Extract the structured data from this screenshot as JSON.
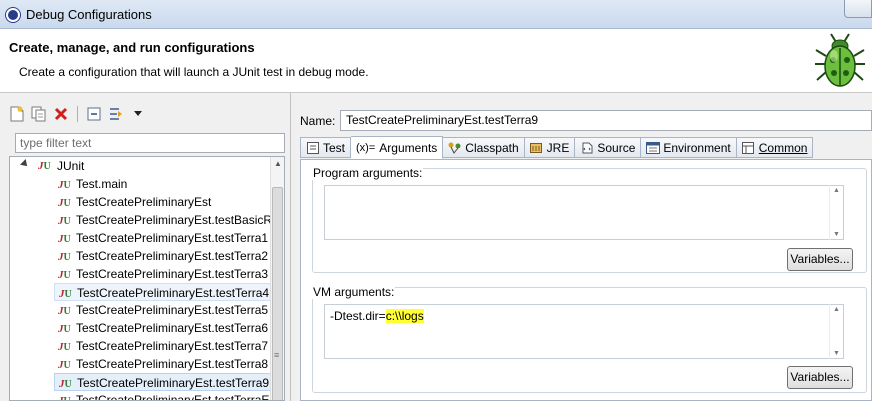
{
  "window": {
    "title": "Debug Configurations"
  },
  "header": {
    "heading": "Create, manage, and run configurations",
    "description": "Create a configuration that will launch a JUnit test in debug mode."
  },
  "sidebar": {
    "filter_placeholder": "type filter text",
    "tree": {
      "category": "JUnit",
      "items": [
        "Test.main",
        "TestCreatePreliminaryEst",
        "TestCreatePreliminaryEst.testBasicRc",
        "TestCreatePreliminaryEst.testTerra1",
        "TestCreatePreliminaryEst.testTerra2",
        "TestCreatePreliminaryEst.testTerra3",
        "TestCreatePreliminaryEst.testTerra4",
        "TestCreatePreliminaryEst.testTerra5",
        "TestCreatePreliminaryEst.testTerra6",
        "TestCreatePreliminaryEst.testTerra7",
        "TestCreatePreliminaryEst.testTerra8",
        "TestCreatePreliminaryEst.testTerra9",
        "TestCreatePreliminaryEst.testTerraEr"
      ],
      "selected_index": 11,
      "hover_index": 6
    }
  },
  "main": {
    "name_label": "Name:",
    "name_value": "TestCreatePreliminaryEst.testTerra9",
    "tabs": [
      {
        "label": "Test",
        "icon": "test-tab-icon"
      },
      {
        "label": "Arguments",
        "icon": "arguments-tab-icon",
        "prefix": "(x)="
      },
      {
        "label": "Classpath",
        "icon": "classpath-tab-icon"
      },
      {
        "label": "JRE",
        "icon": "jre-tab-icon"
      },
      {
        "label": "Source",
        "icon": "source-tab-icon"
      },
      {
        "label": "Environment",
        "icon": "environment-tab-icon"
      },
      {
        "label": "Common",
        "icon": "common-tab-icon"
      }
    ],
    "active_tab": "Arguments",
    "program_args": {
      "label": "Program arguments:",
      "value": "",
      "variables_button": "Variables..."
    },
    "vm_args": {
      "label": "VM arguments:",
      "value_prefix": "-Dtest.dir=",
      "value_highlight": "c:\\\\logs",
      "variables_button": "Variables..."
    },
    "highlight_color": "#ffff33"
  }
}
